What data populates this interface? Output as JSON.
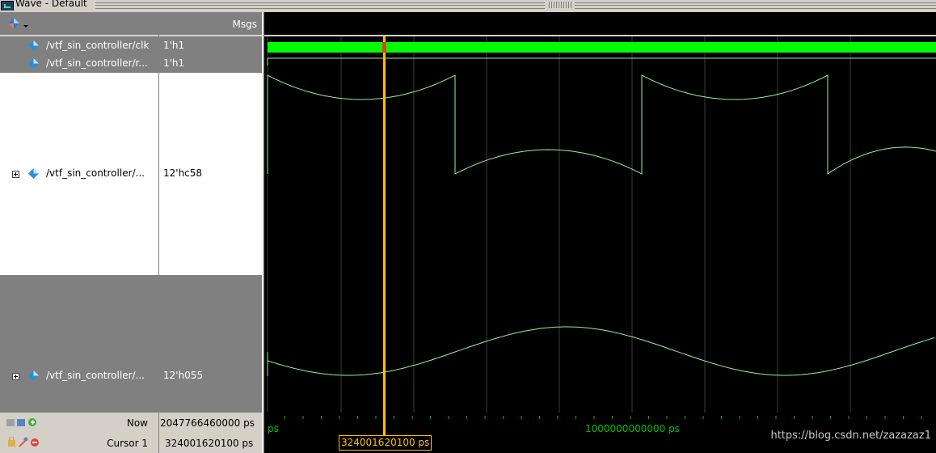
{
  "window": {
    "title": "Wave - Default"
  },
  "header": {
    "msgs_label": "Msgs"
  },
  "signals": [
    {
      "name": "/vtf_sin_controller/clk",
      "value": "1'h1"
    },
    {
      "name": "/vtf_sin_controller/r...",
      "value": "1'h1"
    },
    {
      "name": "/vtf_sin_controller/...",
      "value": "12'hc58"
    },
    {
      "name": "/vtf_sin_controller/...",
      "value": "12'h055"
    }
  ],
  "status": {
    "now_label": "Now",
    "now_value": "2047766460000 ps",
    "cursor_label": "Cursor 1",
    "cursor_value": "324001620100 ps"
  },
  "timeline": {
    "left_label": "ps",
    "tick_label": "1000000000000 ps",
    "cursor_flag": "324001620100 ps"
  },
  "watermark": "https://blog.csdn.net/zazazaz1",
  "colors": {
    "wave": "#9cf09c",
    "clk_fill": "#00ff00",
    "cursor": "#ffc000",
    "grid": "#3c3c3c",
    "panel_gray": "#808080",
    "window_bg": "#d4d0c8"
  },
  "icons": [
    "wave-window-icon",
    "signal-diamond-icon",
    "expand-plus-icon",
    "toolbar-diamond-icon",
    "lock-icon",
    "wrench-icon"
  ]
}
